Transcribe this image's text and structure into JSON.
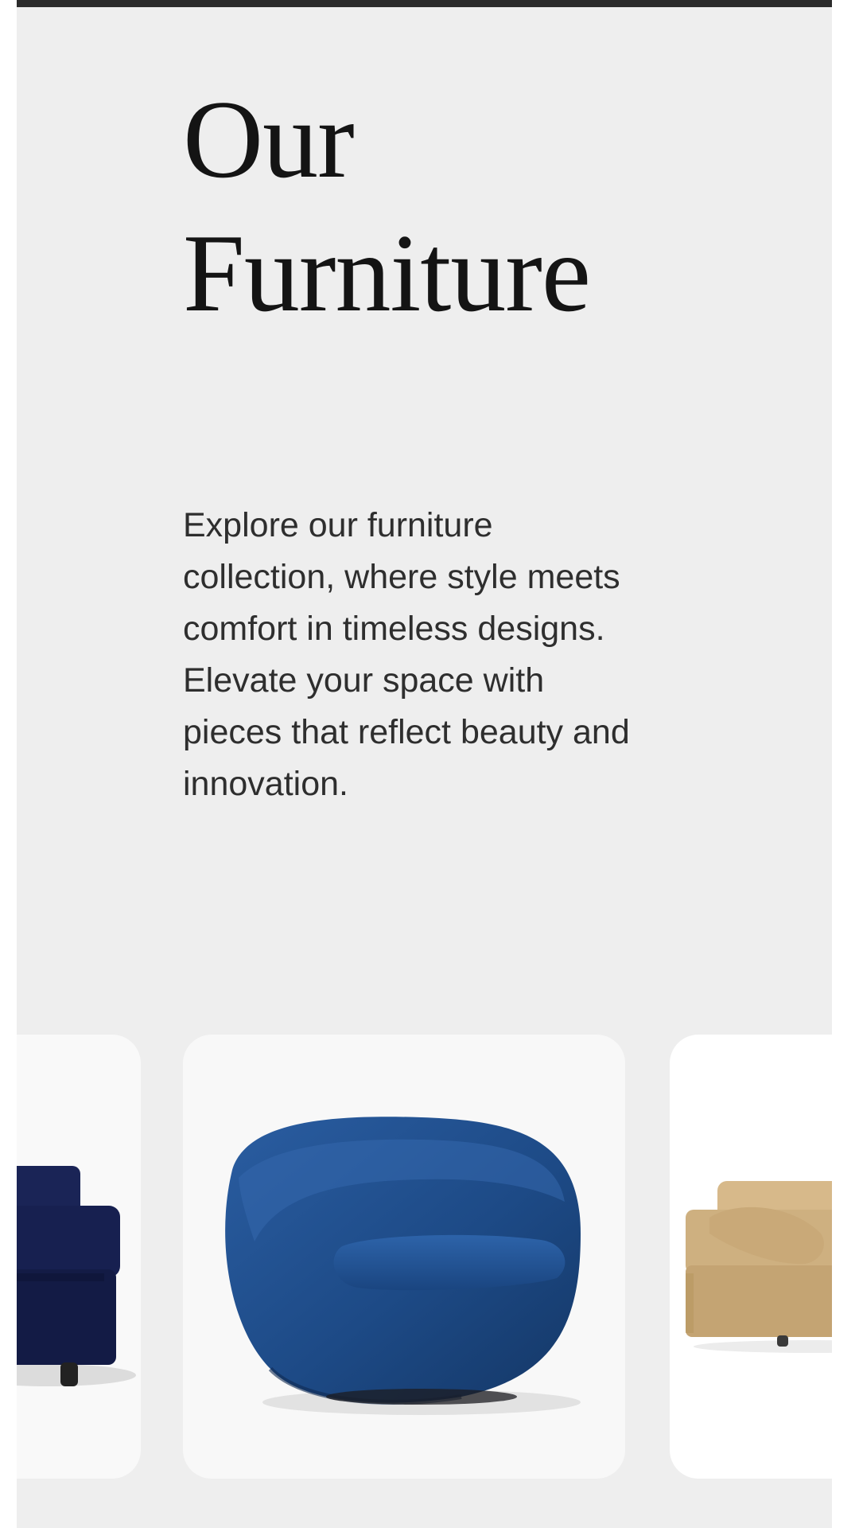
{
  "hero": {
    "title_line1": "Our",
    "title_line2": "Furniture",
    "description": "Explore our furniture collection, where style meets comfort in timeless designs. Elevate your space with pieces that reflect beauty and innovation."
  },
  "carousel": {
    "items": [
      {
        "product": "navy-sofa",
        "color": "#16204f"
      },
      {
        "product": "blue-swivel-chair",
        "color": "#1d4a86"
      },
      {
        "product": "tan-sofa",
        "color": "#cdae7e"
      }
    ]
  },
  "colors": {
    "background": "#eeeeee",
    "top_bar": "#2b2b2b",
    "card": "#f8f8f8"
  }
}
